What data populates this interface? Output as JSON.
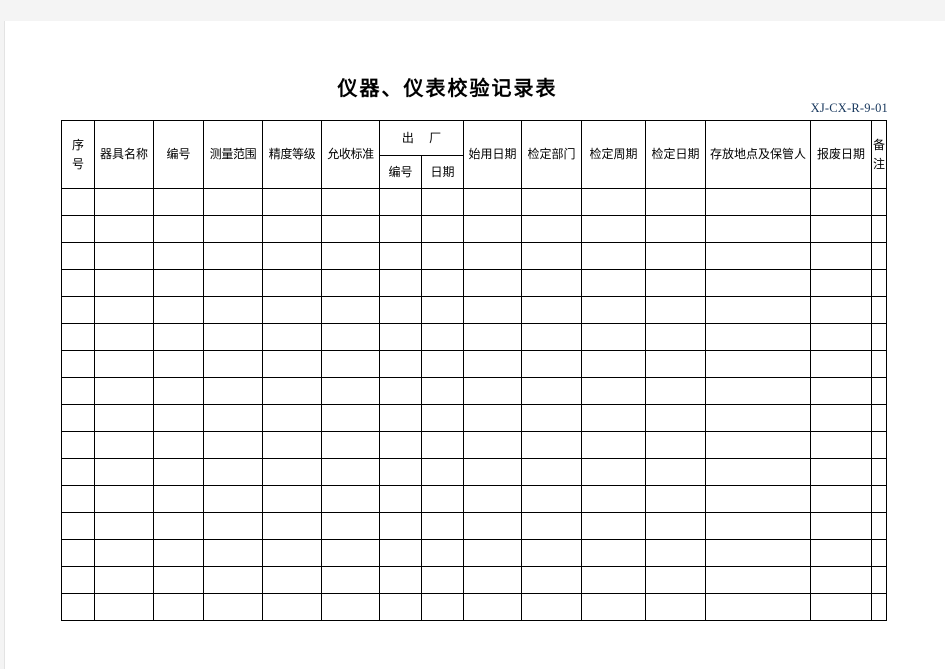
{
  "document": {
    "title": "仪器、仪表校验记录表",
    "code": "XJ-CX-R-9-01"
  },
  "table": {
    "headers": {
      "seq": "序号",
      "seq_char_1": "序",
      "seq_char_2": "号",
      "instrument_name": "器具名称",
      "number": "编号",
      "measuring_range": "测量范围",
      "accuracy_class": "精度等级",
      "acceptance_standard": "允收标准",
      "factory_group": "出 厂",
      "factory_number": "编号",
      "factory_date": "日期",
      "start_use_date": "始用日期",
      "inspection_department": "检定部门",
      "inspection_cycle": "检定周期",
      "inspection_date": "检定日期",
      "storage_and_keeper": "存放地点及保管人",
      "scrap_date": "报废日期",
      "remarks": "备注",
      "remarks_char_1": "备",
      "remarks_char_2": "注"
    },
    "body_row_count": 16,
    "rows": [
      [
        "",
        "",
        "",
        "",
        "",
        "",
        "",
        "",
        "",
        "",
        "",
        "",
        "",
        "",
        ""
      ],
      [
        "",
        "",
        "",
        "",
        "",
        "",
        "",
        "",
        "",
        "",
        "",
        "",
        "",
        "",
        ""
      ],
      [
        "",
        "",
        "",
        "",
        "",
        "",
        "",
        "",
        "",
        "",
        "",
        "",
        "",
        "",
        ""
      ],
      [
        "",
        "",
        "",
        "",
        "",
        "",
        "",
        "",
        "",
        "",
        "",
        "",
        "",
        "",
        ""
      ],
      [
        "",
        "",
        "",
        "",
        "",
        "",
        "",
        "",
        "",
        "",
        "",
        "",
        "",
        "",
        ""
      ],
      [
        "",
        "",
        "",
        "",
        "",
        "",
        "",
        "",
        "",
        "",
        "",
        "",
        "",
        "",
        ""
      ],
      [
        "",
        "",
        "",
        "",
        "",
        "",
        "",
        "",
        "",
        "",
        "",
        "",
        "",
        "",
        ""
      ],
      [
        "",
        "",
        "",
        "",
        "",
        "",
        "",
        "",
        "",
        "",
        "",
        "",
        "",
        "",
        ""
      ],
      [
        "",
        "",
        "",
        "",
        "",
        "",
        "",
        "",
        "",
        "",
        "",
        "",
        "",
        "",
        ""
      ],
      [
        "",
        "",
        "",
        "",
        "",
        "",
        "",
        "",
        "",
        "",
        "",
        "",
        "",
        "",
        ""
      ],
      [
        "",
        "",
        "",
        "",
        "",
        "",
        "",
        "",
        "",
        "",
        "",
        "",
        "",
        "",
        ""
      ],
      [
        "",
        "",
        "",
        "",
        "",
        "",
        "",
        "",
        "",
        "",
        "",
        "",
        "",
        "",
        ""
      ],
      [
        "",
        "",
        "",
        "",
        "",
        "",
        "",
        "",
        "",
        "",
        "",
        "",
        "",
        "",
        ""
      ],
      [
        "",
        "",
        "",
        "",
        "",
        "",
        "",
        "",
        "",
        "",
        "",
        "",
        "",
        "",
        ""
      ],
      [
        "",
        "",
        "",
        "",
        "",
        "",
        "",
        "",
        "",
        "",
        "",
        "",
        "",
        "",
        ""
      ],
      [
        "",
        "",
        "",
        "",
        "",
        "",
        "",
        "",
        "",
        "",
        "",
        "",
        "",
        "",
        ""
      ]
    ]
  },
  "colors": {
    "page_background": "#ffffff",
    "canvas_background": "#f4f4f4",
    "grid_line": "#000000",
    "code_text": "#16365c"
  }
}
